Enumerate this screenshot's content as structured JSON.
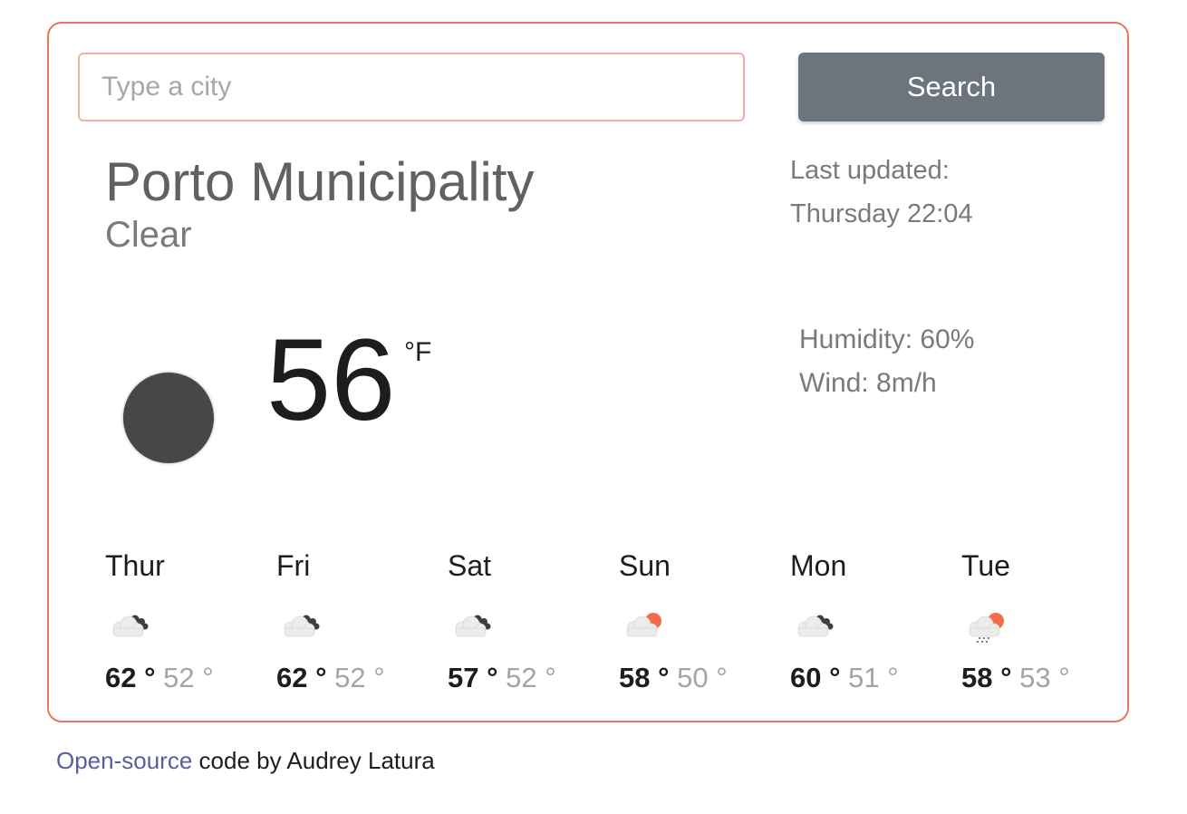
{
  "search": {
    "placeholder": "Type a city",
    "value": "",
    "button_label": "Search"
  },
  "current": {
    "city": "Porto Municipality",
    "description": "Clear",
    "last_updated_label": "Last updated:",
    "last_updated_value": "Thursday 22:04",
    "temperature": "56",
    "unit": "°F",
    "humidity": "Humidity: 60%",
    "wind": "Wind: 8m/h",
    "icon": "moon-icon"
  },
  "forecast": [
    {
      "day": "Thur",
      "max": "62",
      "min": "52",
      "icon": "cloudy-icon"
    },
    {
      "day": "Fri",
      "max": "62",
      "min": "52",
      "icon": "cloudy-icon"
    },
    {
      "day": "Sat",
      "max": "57",
      "min": "52",
      "icon": "cloudy-icon"
    },
    {
      "day": "Sun",
      "max": "58",
      "min": "50",
      "icon": "partly-sunny-icon"
    },
    {
      "day": "Mon",
      "max": "60",
      "min": "51",
      "icon": "cloudy-icon"
    },
    {
      "day": "Tue",
      "max": "58",
      "min": "53",
      "icon": "sun-rain-icon"
    }
  ],
  "degree_symbol": "°",
  "footer": {
    "link_text": "Open-source",
    "rest_text": " code by Audrey Latura"
  },
  "colors": {
    "accent_border": "#e9755f",
    "sun": "#f26b4a",
    "button": "#6c757d"
  }
}
